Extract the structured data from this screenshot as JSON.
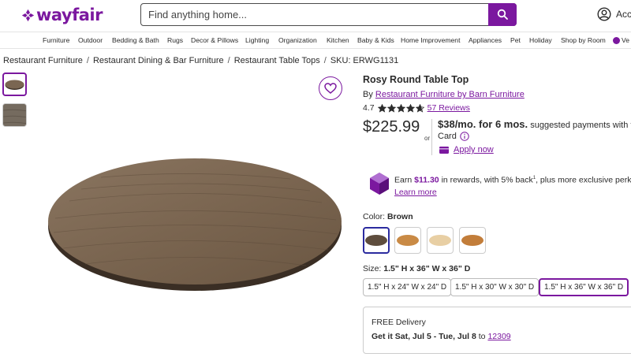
{
  "header": {
    "logo_text": "wayfair",
    "search_placeholder": "Find anything home...",
    "account_label": "Acco",
    "brand_color": "#7b189f"
  },
  "nav": {
    "items": [
      "Furniture",
      "Outdoor",
      "Bedding & Bath",
      "Rugs",
      "Decor & Pillows",
      "Lighting",
      "Organization",
      "Kitchen",
      "Baby & Kids",
      "Home Improvement",
      "Appliances",
      "Pet",
      "Holiday",
      "Shop by Room",
      "Ve"
    ]
  },
  "breadcrumb": {
    "items": [
      "Restaurant Furniture",
      "Restaurant Dining & Bar Furniture",
      "Restaurant Table Tops"
    ],
    "sku": "SKU: ERWG1131"
  },
  "product": {
    "title": "Rosy Round Table Top",
    "by_prefix": "By ",
    "brand": "Restaurant Furniture by Barn Furniture",
    "rating": "4.7",
    "rating_value": 4.7,
    "reviews": "57 Reviews",
    "price": "$225.99",
    "or": "or",
    "finance_amount": "$38/mo. for 6 mos.",
    "finance_suffix": " suggested payments with the W",
    "card_word": "Card",
    "apply_now": "Apply now"
  },
  "rewards": {
    "earn": "Earn ",
    "amount": "$11.30",
    "rest_a": " in rewards, with 5% back",
    "superscript": "1",
    "rest_b": ", plus more exclusive perks",
    "learn_more": "Learn more"
  },
  "color": {
    "label": "Color: ",
    "selected": "Brown",
    "swatches": [
      {
        "name": "Brown",
        "hex": "#6b5a48"
      },
      {
        "name": "Natural",
        "hex": "#c98a45"
      },
      {
        "name": "Light",
        "hex": "#e8cfa4"
      },
      {
        "name": "Honey",
        "hex": "#c27d3a"
      }
    ]
  },
  "size": {
    "label": "Size: ",
    "selected": "1.5\" H x 36\" W x 36\" D",
    "options": [
      "1.5\" H x 24\" W x 24\" D",
      "1.5\" H x 30\" W x 30\" D",
      "1.5\" H x 36\" W x 36\" D"
    ]
  },
  "delivery": {
    "title": "FREE Delivery",
    "get_it": "Get it Sat, Jul 5 - Tue, Jul 8",
    "to": " to ",
    "zip": "12309"
  }
}
